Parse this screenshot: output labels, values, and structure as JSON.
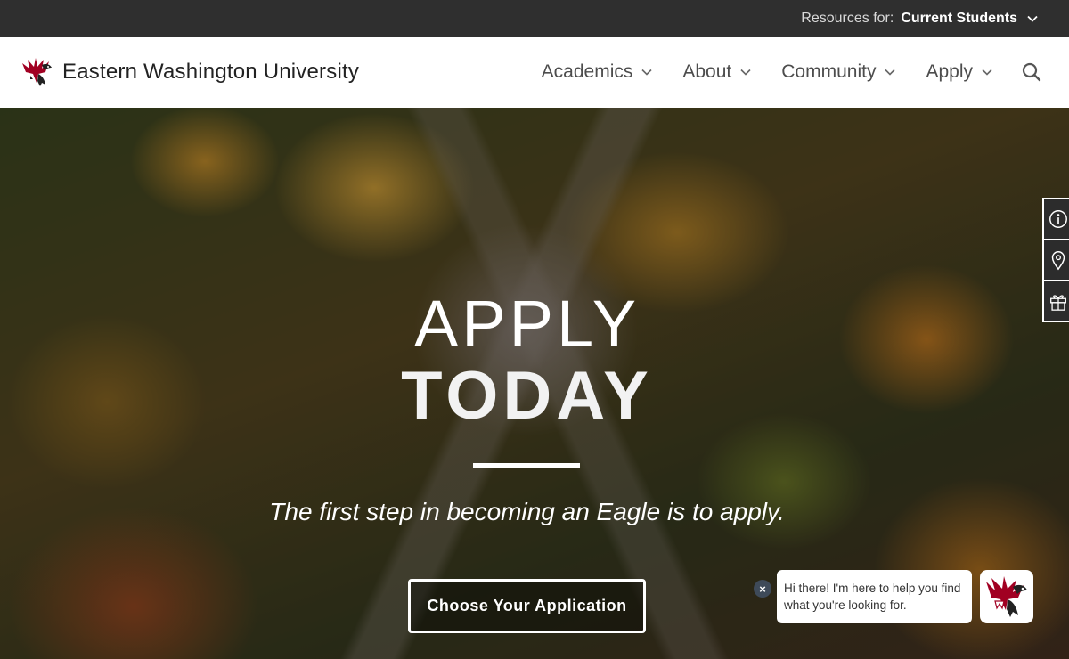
{
  "topbar": {
    "resources_label": "Resources for:",
    "resources_value": "Current Students"
  },
  "header": {
    "brand_name": "Eastern Washington University",
    "nav": [
      {
        "label": "Academics"
      },
      {
        "label": "About"
      },
      {
        "label": "Community"
      },
      {
        "label": "Apply"
      }
    ],
    "search_icon": "search-icon"
  },
  "hero": {
    "title_line1": "APPLY",
    "title_line2": "TODAY",
    "subtitle": "The first step in becoming an Eagle is to apply.",
    "cta_label": "Choose Your Application"
  },
  "side_tabs": [
    {
      "icon": "info-icon"
    },
    {
      "icon": "map-pin-icon"
    },
    {
      "icon": "gift-icon"
    }
  ],
  "chat": {
    "close_label": "×",
    "message": "Hi there! I'm here to help you find what you're looking for."
  },
  "colors": {
    "topbar_bg": "#2f2f2f",
    "brand_red": "#a10022",
    "header_bg": "#ffffff",
    "nav_text": "#4d4d4d"
  }
}
